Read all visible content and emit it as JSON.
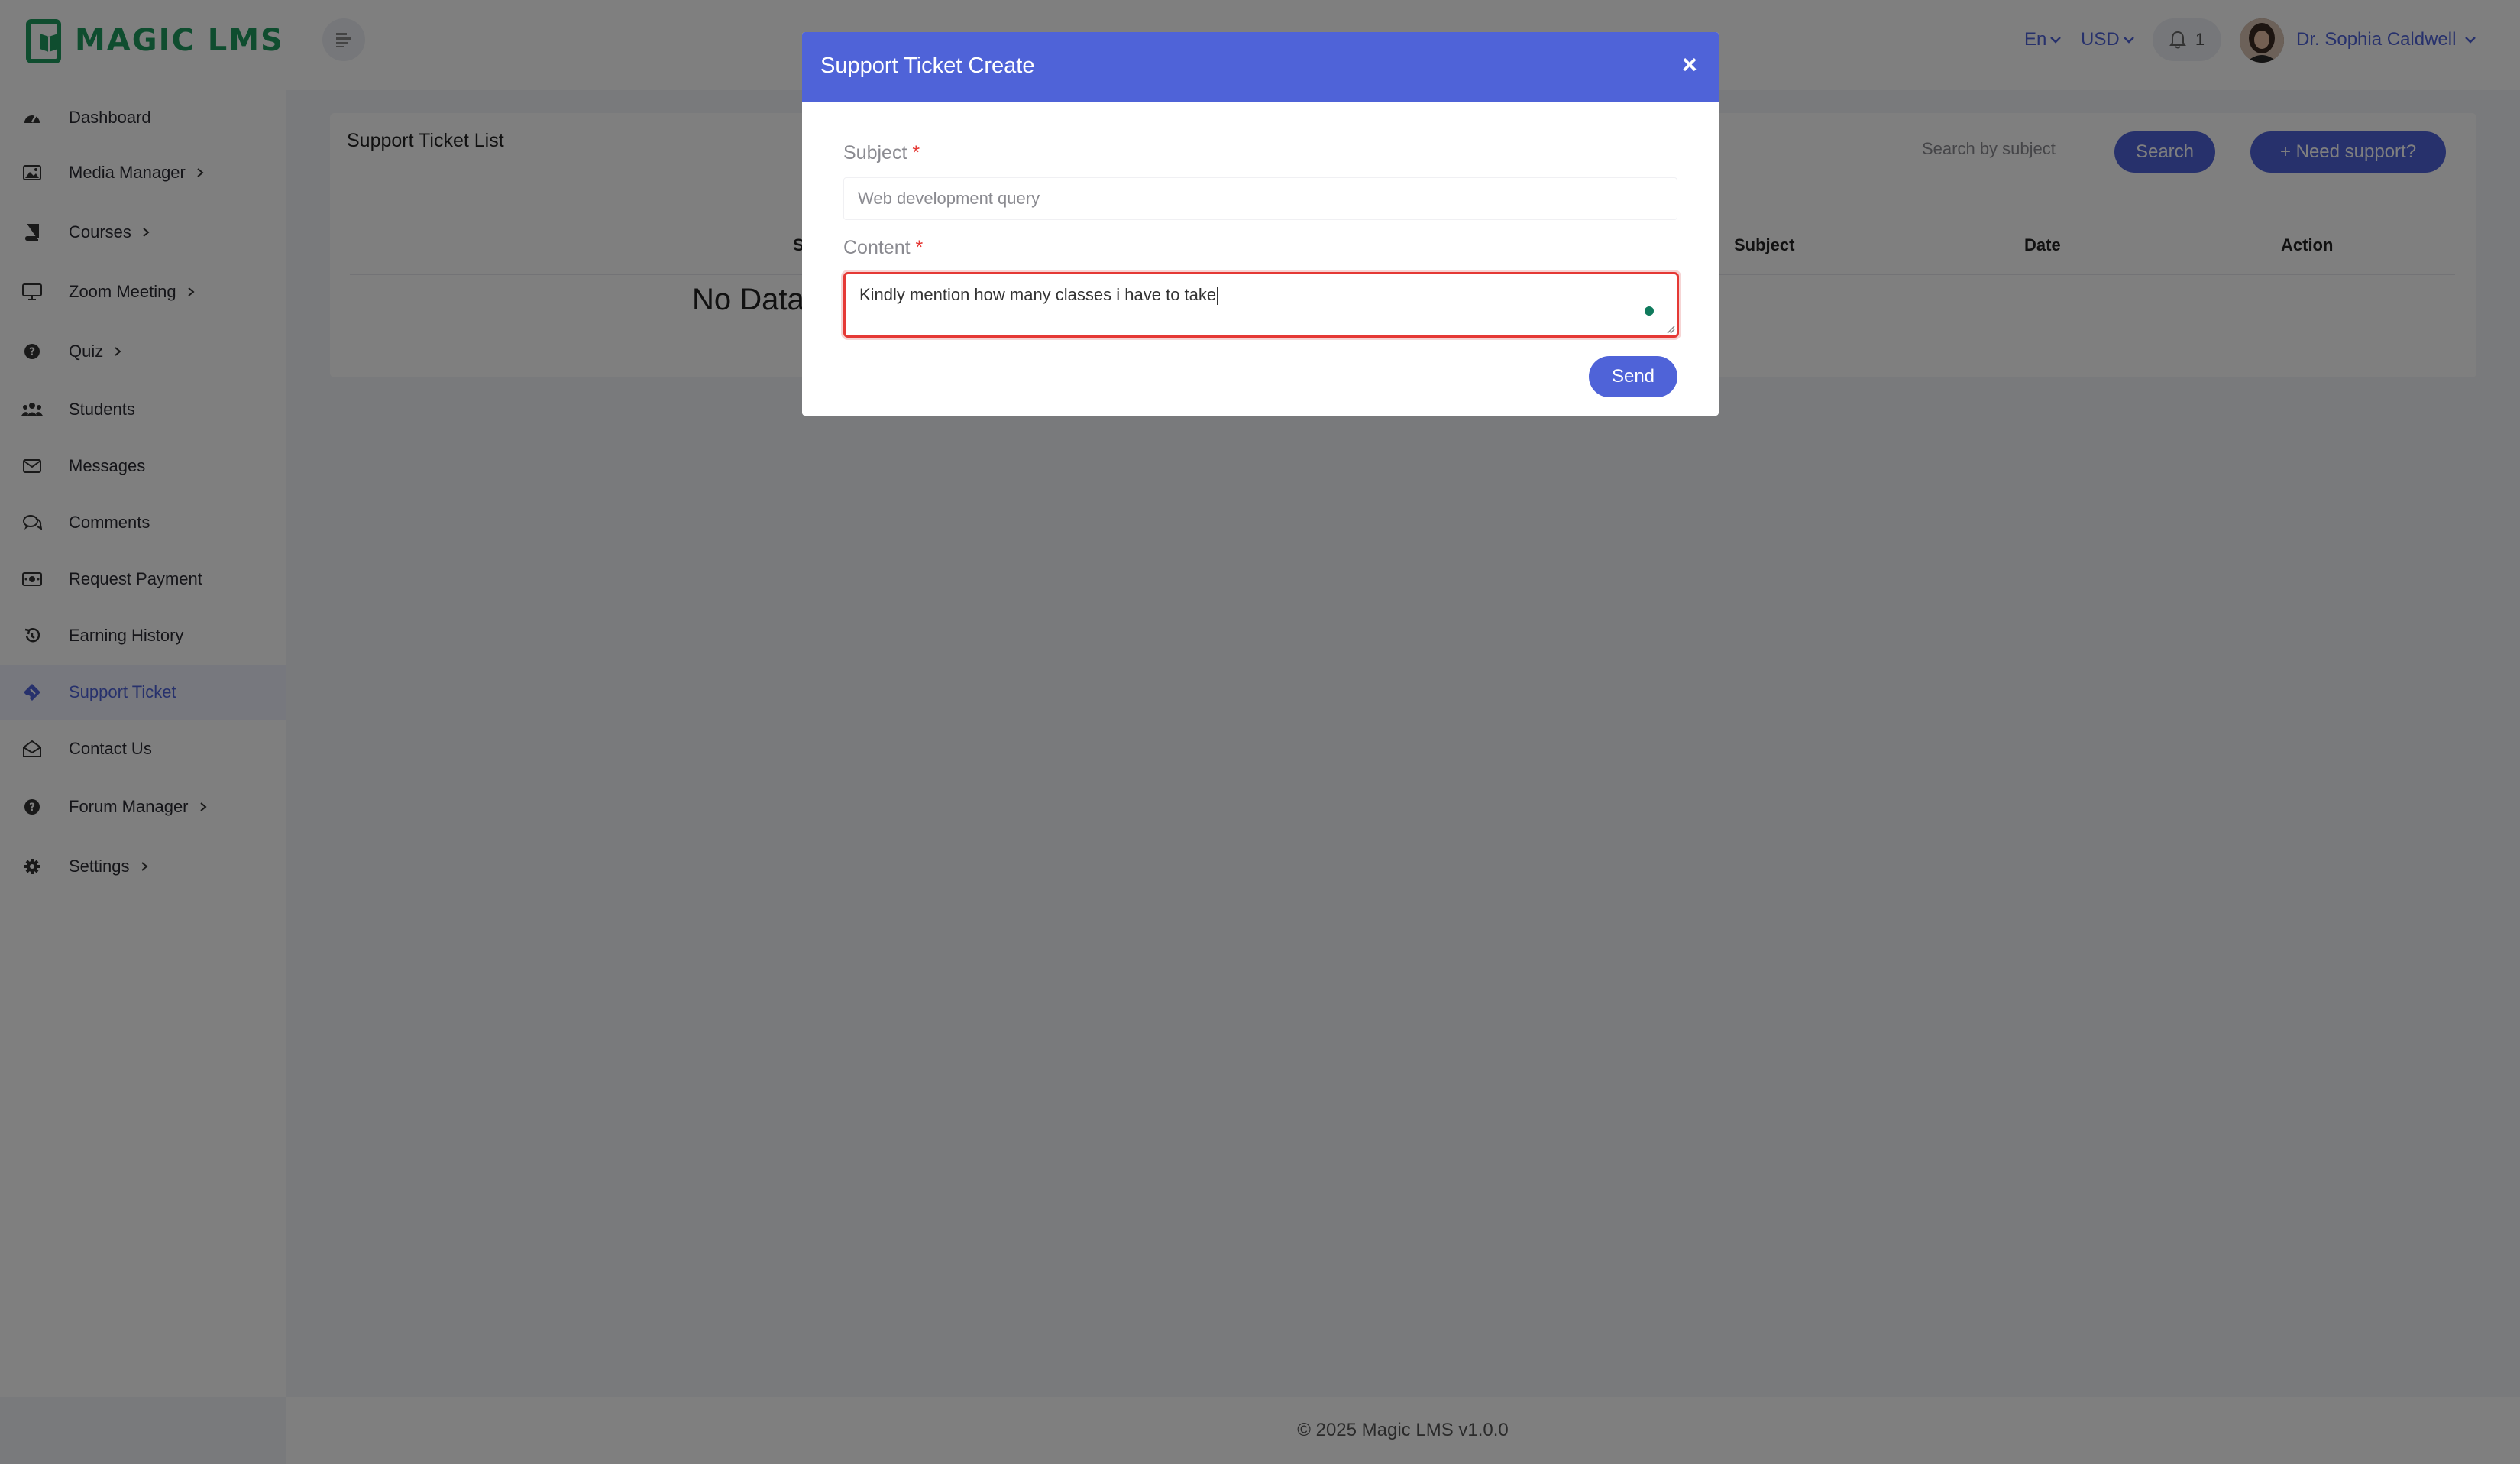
{
  "header": {
    "logo_text": "MAGIC LMS",
    "language": "En",
    "currency": "USD",
    "notification_count": "1",
    "user_name": "Dr. Sophia Caldwell"
  },
  "sidebar": {
    "items": [
      {
        "label": "Dashboard",
        "icon": "dashboard-icon",
        "has_children": false
      },
      {
        "label": "Media Manager",
        "icon": "image-icon",
        "has_children": true
      },
      {
        "label": "Courses",
        "icon": "book-icon",
        "has_children": true
      },
      {
        "label": "Zoom Meeting",
        "icon": "monitor-icon",
        "has_children": true
      },
      {
        "label": "Quiz",
        "icon": "question-icon",
        "has_children": true
      },
      {
        "label": "Students",
        "icon": "users-icon",
        "has_children": false
      },
      {
        "label": "Messages",
        "icon": "envelope-icon",
        "has_children": false
      },
      {
        "label": "Comments",
        "icon": "comments-icon",
        "has_children": false
      },
      {
        "label": "Request Payment",
        "icon": "money-icon",
        "has_children": false
      },
      {
        "label": "Earning History",
        "icon": "history-icon",
        "has_children": false
      },
      {
        "label": "Support Ticket",
        "icon": "ticket-icon",
        "has_children": false,
        "active": true
      },
      {
        "label": "Contact Us",
        "icon": "mail-open-icon",
        "has_children": false
      },
      {
        "label": "Forum Manager",
        "icon": "question-icon",
        "has_children": true
      },
      {
        "label": "Settings",
        "icon": "gear-icon",
        "has_children": true
      }
    ]
  },
  "main": {
    "title": "Support Ticket List",
    "search_placeholder": "Search by subject",
    "search_button": "Search",
    "need_support_button": "+ Need support?",
    "columns": [
      "S",
      "Subject",
      "Date",
      "Action"
    ],
    "empty_text": "No Data"
  },
  "modal": {
    "title": "Support Ticket Create",
    "close_symbol": "×",
    "subject_label": "Subject",
    "subject_placeholder": "Web development query",
    "content_label": "Content",
    "required_mark": "*",
    "content_value": "Kindly mention how many classes i have to take",
    "send_button": "Send"
  },
  "footer": {
    "text": "© 2025 Magic LMS v1.0.0"
  },
  "colors": {
    "primary": "#4f63d8",
    "brand_green": "#1e9a5e",
    "error": "#e53935"
  }
}
